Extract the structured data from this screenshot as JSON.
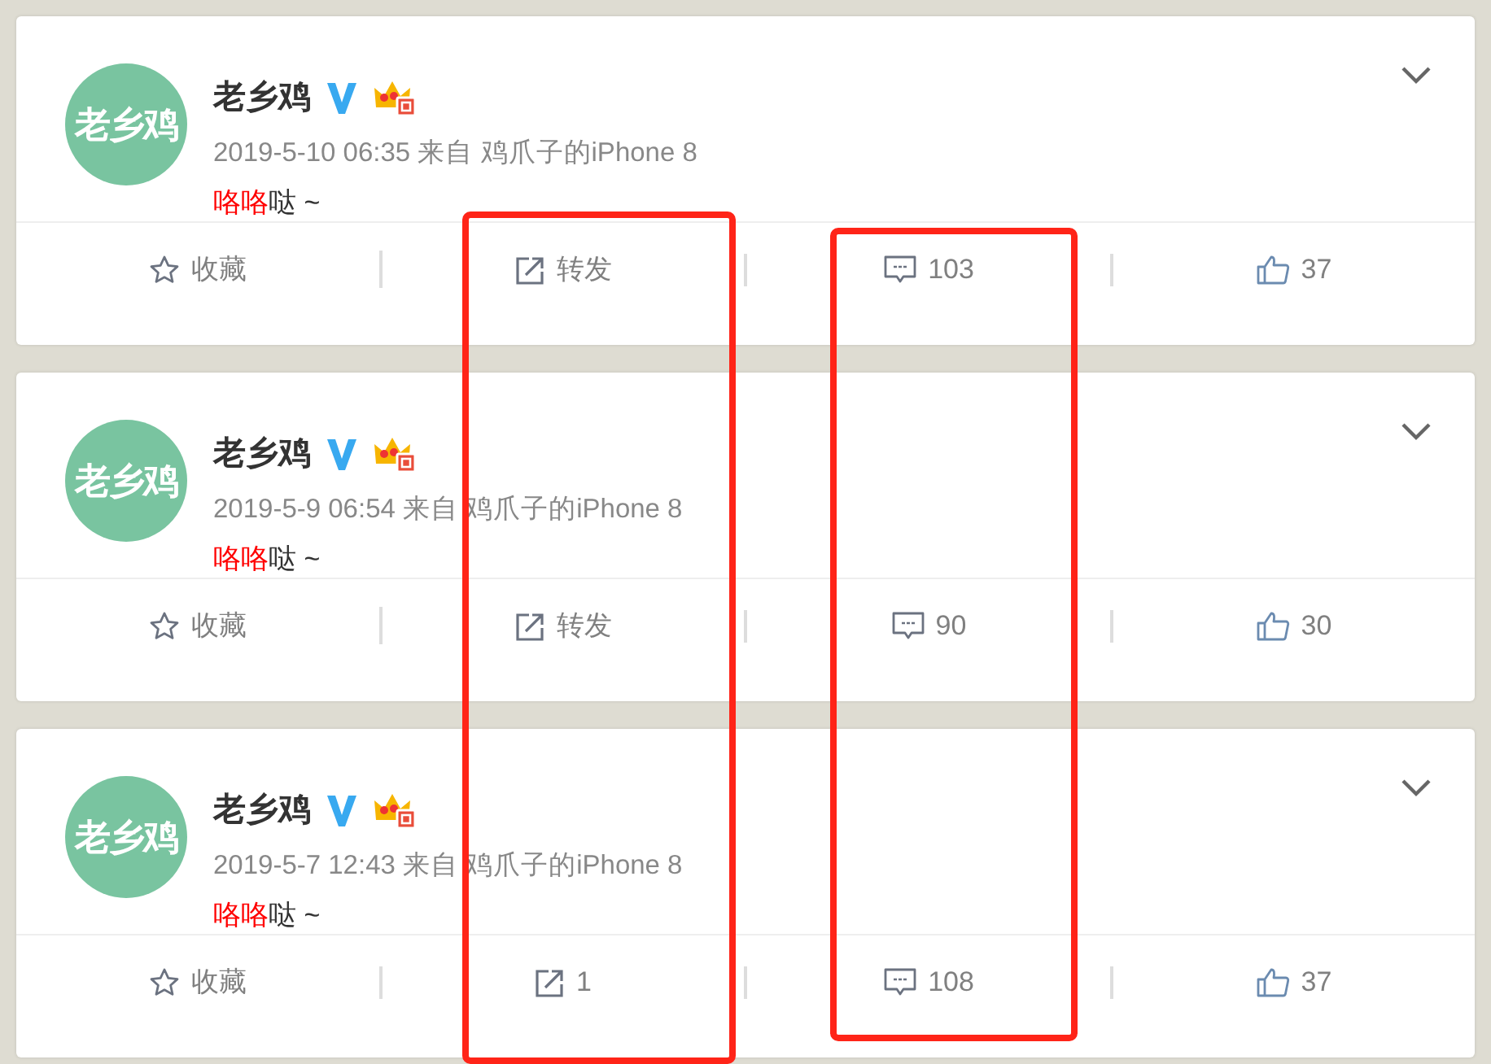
{
  "posts": [
    {
      "author": "老乡鸡",
      "avatar_text": "老乡鸡",
      "verified": true,
      "member": true,
      "meta": "2019-5-10 06:35 来自 鸡爪子的iPhone 8",
      "text": [
        {
          "text": "咯咯",
          "highlight": true
        },
        {
          "text": "哒 ~",
          "highlight": false
        }
      ],
      "actions": [
        {
          "kind": "favorite",
          "label": "收藏"
        },
        {
          "kind": "repost",
          "label": "转发"
        },
        {
          "kind": "comment",
          "label": "103"
        },
        {
          "kind": "like",
          "label": "37"
        }
      ]
    },
    {
      "author": "老乡鸡",
      "avatar_text": "老乡鸡",
      "verified": true,
      "member": true,
      "meta": "2019-5-9 06:54 来自 鸡爪子的iPhone 8",
      "text": [
        {
          "text": "咯咯",
          "highlight": true
        },
        {
          "text": "哒 ~",
          "highlight": false
        }
      ],
      "actions": [
        {
          "kind": "favorite",
          "label": "收藏"
        },
        {
          "kind": "repost",
          "label": "转发"
        },
        {
          "kind": "comment",
          "label": "90"
        },
        {
          "kind": "like",
          "label": "30"
        }
      ]
    },
    {
      "author": "老乡鸡",
      "avatar_text": "老乡鸡",
      "verified": true,
      "member": true,
      "meta": "2019-5-7 12:43 来自 鸡爪子的iPhone 8",
      "text": [
        {
          "text": "咯咯",
          "highlight": true
        },
        {
          "text": "哒 ~",
          "highlight": false
        }
      ],
      "actions": [
        {
          "kind": "favorite",
          "label": "收藏"
        },
        {
          "kind": "repost",
          "label": "1"
        },
        {
          "kind": "comment",
          "label": "108"
        },
        {
          "kind": "like",
          "label": "37"
        }
      ]
    }
  ],
  "highlight_frames": [
    {
      "color": "#ff2418"
    },
    {
      "color": "#ff2418"
    }
  ]
}
